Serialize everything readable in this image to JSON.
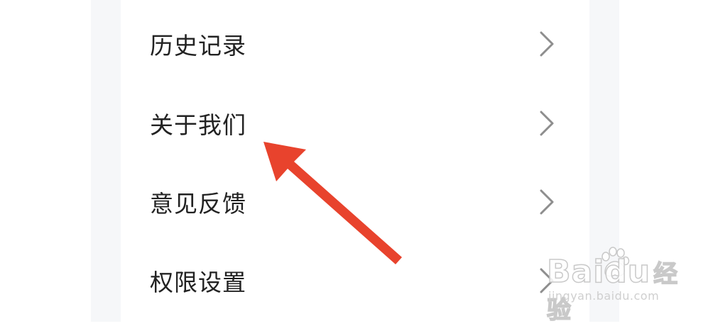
{
  "menu": {
    "items": [
      {
        "label": "历史记录",
        "icon": "chevron-right-icon"
      },
      {
        "label": "关于我们",
        "icon": "chevron-right-icon"
      },
      {
        "label": "意见反馈",
        "icon": "chevron-right-icon"
      },
      {
        "label": "权限设置",
        "icon": "chevron-right-icon"
      }
    ]
  },
  "watermark": {
    "brand": "Baidu",
    "brand_cn": "经验",
    "url": "jingyan.baidu.com"
  },
  "colors": {
    "label_text": "#222222",
    "chevron": "#8e8e8e",
    "annotation_arrow": "#e8432d",
    "side_background": "#f6f7f9"
  }
}
